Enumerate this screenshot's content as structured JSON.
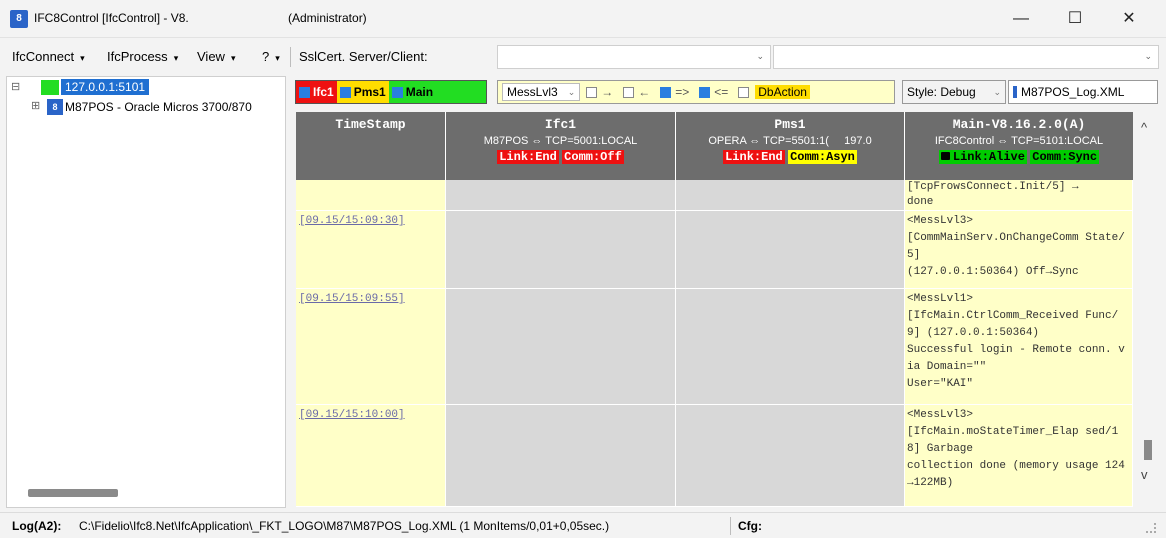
{
  "window": {
    "title": "IFC8Control [IfcControl] - V8.",
    "admin": "(Administrator)",
    "icon_text": "8",
    "minimize": "—",
    "maximize": "☐",
    "close": "✕"
  },
  "menu": [
    {
      "label": "IfcConnect"
    },
    {
      "label": "IfcProcess"
    },
    {
      "label": "View"
    },
    {
      "label": "?"
    }
  ],
  "menu_chevron": "▾",
  "sslcert_label": "SslCert. Server/Client:",
  "combo_arrow": "⌄",
  "tree": {
    "root_ip": "127.0.0.1:5101",
    "child_label": "M87POS - Oracle Micros 3700/870",
    "child_icon": "8",
    "expand_root": "⊟",
    "expand_child": "⊞"
  },
  "toolbar": {
    "ifc1": "Ifc1",
    "pms1": "Pms1",
    "main": "Main",
    "messlvl": "MessLvl3",
    "arrow_right": "→",
    "arrow_left": "←",
    "arrow_dbl_right": "=>",
    "arrow_dbl_left": "<=",
    "dbaction": "DbAction",
    "style": "Style: Debug",
    "logfile": "M87POS_Log.XML"
  },
  "grid": {
    "headers": {
      "timestamp": "TimeStamp",
      "ifc1": {
        "name": "Ifc1",
        "conn": "M87POS ⇔ TCP=5001:LOCAL",
        "link": "Link:End",
        "comm": "Comm:Off"
      },
      "pms1": {
        "name": "Pms1",
        "conn": "OPERA ⇔ TCP=5501:1(",
        "num": "197.0",
        "link": "Link:End",
        "comm": "Comm:Asyn"
      },
      "main": {
        "name": "Main-V8.16.2.0(A)",
        "conn": "IFC8Control ⇔ TCP=5101:LOCAL",
        "link": "Link:Alive",
        "comm": "Comm:Sync"
      }
    },
    "rows": [
      {
        "timestamp": "",
        "log": "[TcpFrowsConnect.Init/5] →\ndone"
      },
      {
        "timestamp": "[09.15/15:09:30]",
        "log": "<MessLvl3>\n[CommMainServ.OnChangeComm State/5]\n(127.0.0.1:50364) Off→Sync"
      },
      {
        "timestamp": "[09.15/15:09:55]",
        "log": "<MessLvl1>\n[IfcMain.CtrlComm_Received Func/9] (127.0.0.1:50364)\nSuccessful login - Remote conn. via Domain=\"\"\nUser=\"KAI\""
      },
      {
        "timestamp": "[09.15/15:10:00]",
        "log": "<MessLvl3>\n[IfcMain.moStateTimer_Elap sed/18] Garbage\ncollection done (memory usage 124→122MB)"
      }
    ]
  },
  "scroll": {
    "up": "^",
    "down": "v"
  },
  "status": {
    "log_label": "Log(A2):",
    "log_path": "C:\\Fidelio\\Ifc8.Net\\IfcApplication\\_FKT_LOGO\\M87\\M87POS_Log.XML (1 MonItems/0,01+0,05sec.)",
    "cfg_label": "Cfg:"
  }
}
